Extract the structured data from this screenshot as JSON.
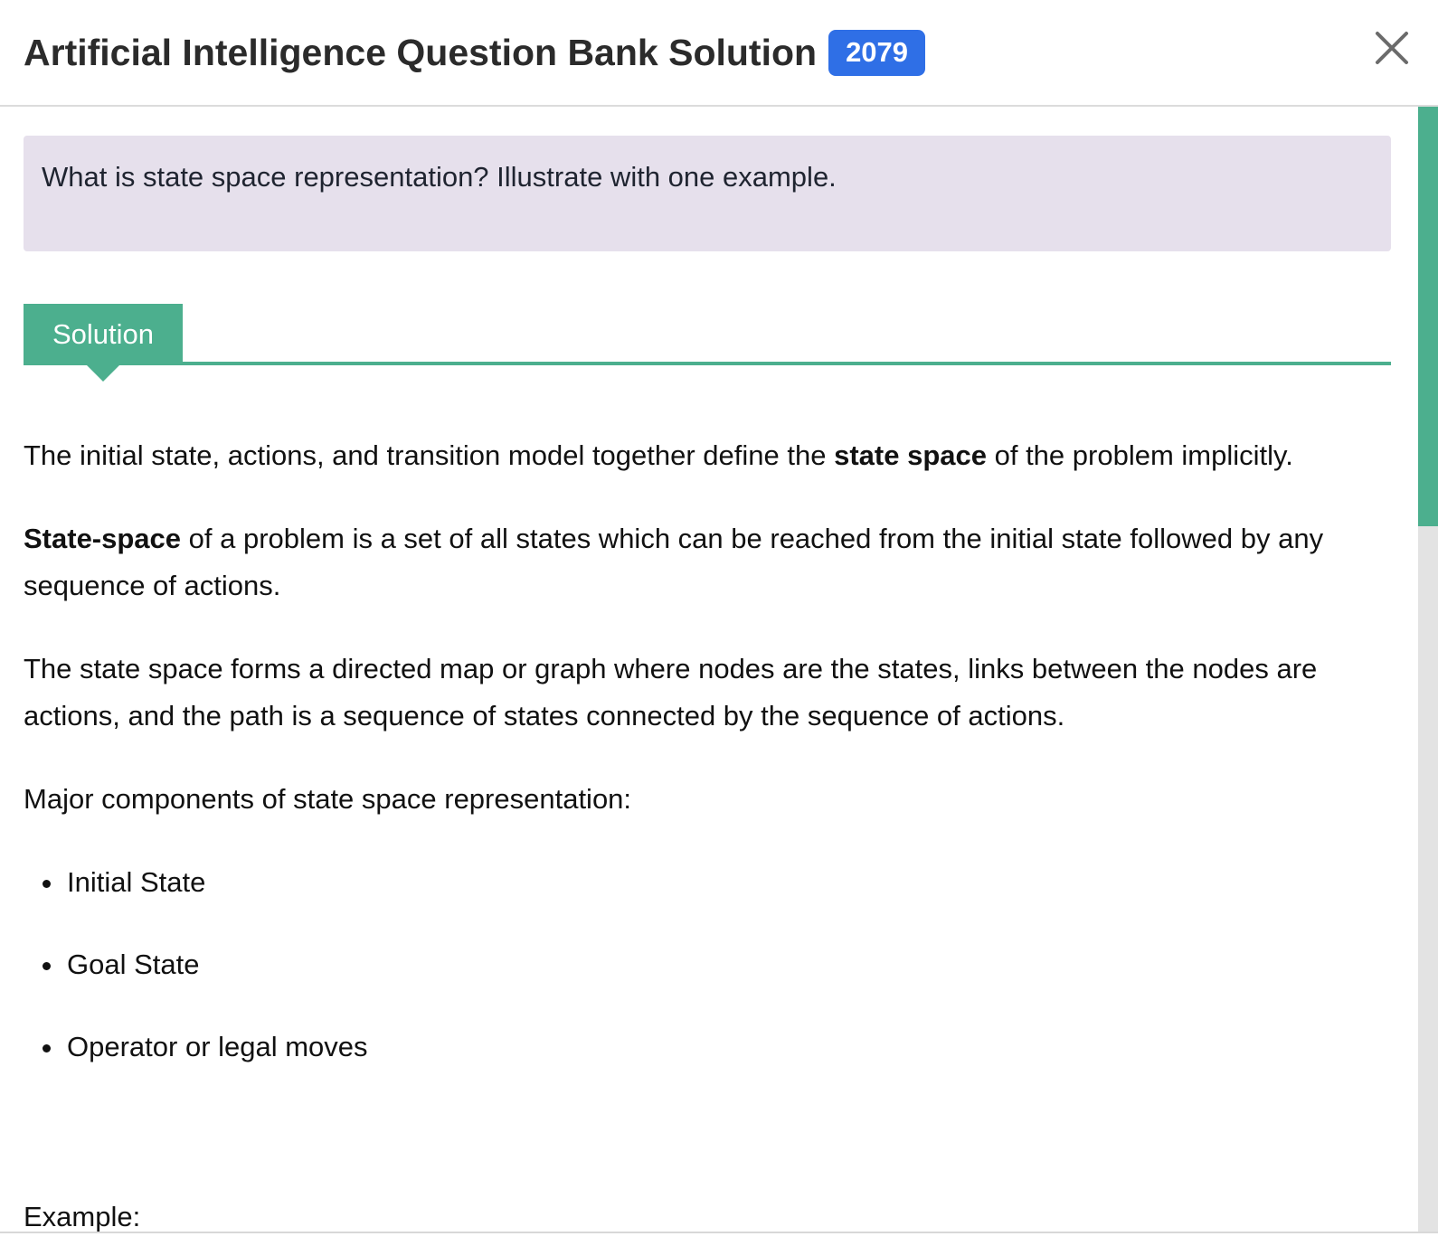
{
  "header": {
    "title": "Artificial Intelligence Question Bank Solution",
    "badge": "2079",
    "close_icon": "close-icon"
  },
  "question": {
    "text": "What is state space representation? Illustrate with one example."
  },
  "solution_tab": {
    "label": "Solution"
  },
  "content": {
    "p1_before": "The initial state, actions, and transition model together define the ",
    "p1_bold": "state space",
    "p1_after": " of the problem implicitly.",
    "p2_bold": "State-space",
    "p2_after": " of a problem is a set of all states which can be reached from the initial state followed by any sequence of actions.",
    "p3": "The state space forms a directed map or graph where nodes are the states, links between the nodes are actions, and the path is a sequence of states connected by the sequence of actions.",
    "p4": "Major components of state space representation:",
    "components": [
      "Initial State",
      "Goal State",
      "Operator or legal moves"
    ],
    "example_label": "Example:"
  },
  "colors": {
    "accent_green": "#4caf8e",
    "badge_blue": "#2f6fe6",
    "question_bg": "#e6e0ec"
  }
}
